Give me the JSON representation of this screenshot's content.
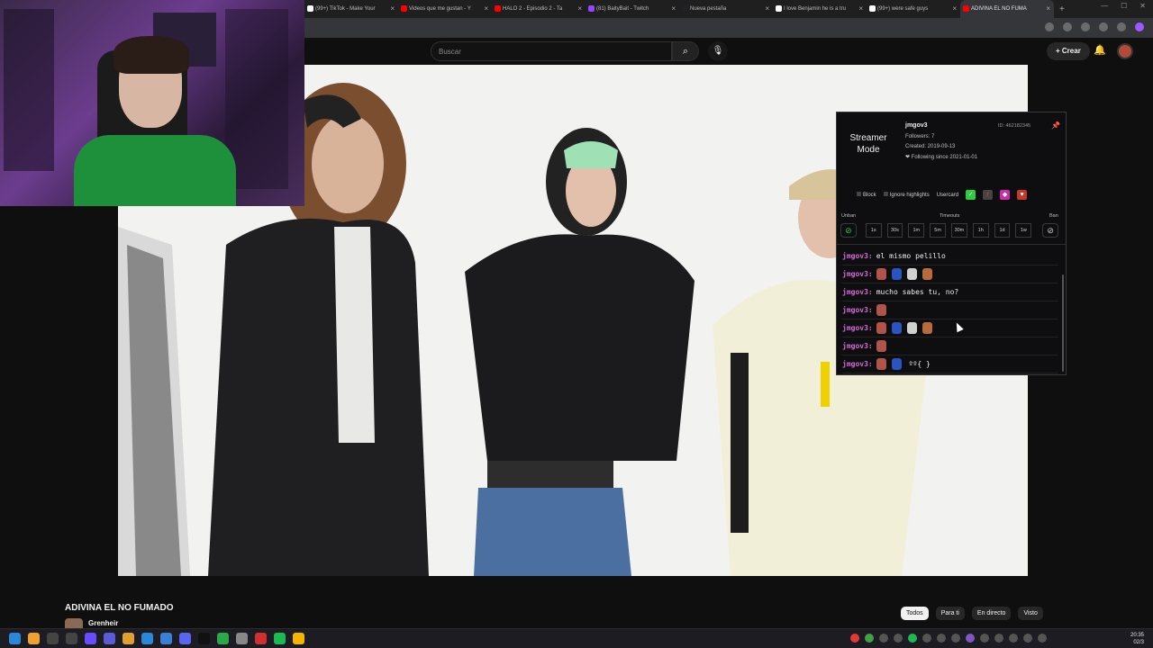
{
  "browser": {
    "tabs": [
      {
        "label": "(99+) TikTok - Make Your",
        "color": "#ffffff",
        "active": false
      },
      {
        "label": "Videos que me gustan - Y",
        "color": "#ff0000",
        "active": false
      },
      {
        "label": "HALO 2 - Episodio 2 - Ta",
        "color": "#ff0000",
        "active": false
      },
      {
        "label": "(81) BaityBait - Twitch",
        "color": "#9146ff",
        "active": false
      },
      {
        "label": "Nueva pestaña",
        "color": "#202124",
        "active": false
      },
      {
        "label": "I love Benjamin he is a tru",
        "color": "#ffffff",
        "active": false
      },
      {
        "label": "(99+) were safe guys",
        "color": "#ffffff",
        "active": false
      },
      {
        "label": "ADIVINA EL NO FUMA",
        "color": "#ff0000",
        "active": true
      }
    ],
    "new_tab": "+"
  },
  "youtube": {
    "search_placeholder": "Buscar",
    "create_label": "Crear",
    "video_title": "ADIVINA EL NO FUMADO",
    "channel_name": "Grenheir",
    "chips": [
      "Todos",
      "Para ti",
      "En directo",
      "Visto"
    ]
  },
  "usercard": {
    "mode_label": "Streamer Mode",
    "username": "jmgov3",
    "followers": "Followers: 7",
    "created": "Created: 2019-09-13",
    "following": "❤ Following since 2021-01-01",
    "id": "ID: 462182345",
    "block_label": "Block",
    "ignore_label": "Ignore highlights",
    "usercard_label": "Usercard",
    "unban_label": "Unban",
    "timeouts_label": "Timeouts",
    "ban_label": "Ban",
    "timeouts": [
      "1s",
      "30s",
      "1m",
      "5m",
      "30m",
      "1h",
      "1d",
      "1w"
    ],
    "messages": [
      {
        "user": "jmgov3:",
        "text": "el mismo pelillo",
        "emotes": 0
      },
      {
        "user": "jmgov3:",
        "text": "",
        "emotes": 4
      },
      {
        "user": "jmgov3:",
        "text": "mucho sabes tu, no?",
        "emotes": 0
      },
      {
        "user": "jmgov3:",
        "text": "",
        "emotes": 1
      },
      {
        "user": "jmgov3:",
        "text": "",
        "emotes": 4
      },
      {
        "user": "jmgov3:",
        "text": "",
        "emotes": 1
      },
      {
        "user": "jmgov3:",
        "text": "",
        "emotes": 2,
        "suffix": "ºº{ }"
      }
    ]
  },
  "clock": {
    "time": "20:35",
    "date": "02/3"
  },
  "colors": {
    "accent": "#9146ff",
    "chat_user": "#d56ad6",
    "bg": "#0f0f0f"
  }
}
